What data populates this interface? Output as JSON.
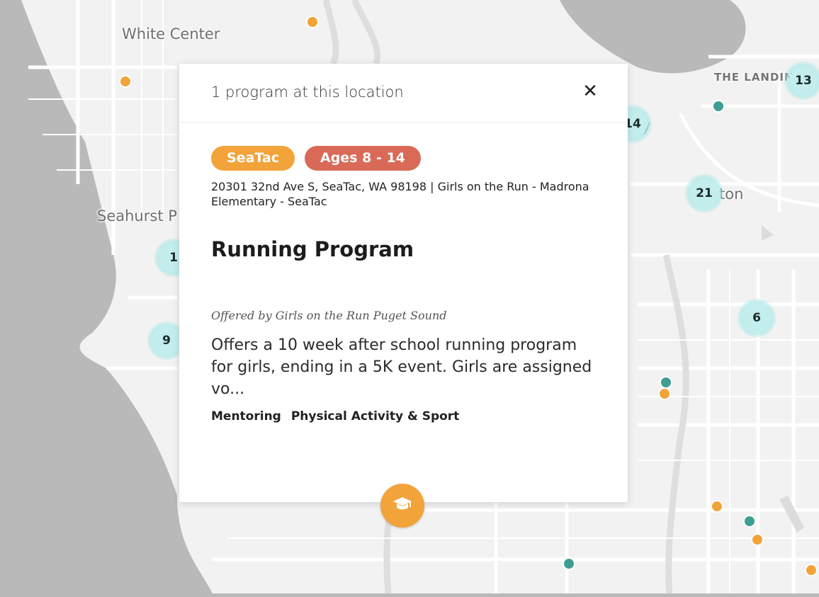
{
  "map": {
    "place_labels": [
      "White Center",
      "Seahurst P",
      "THE LANDIN",
      "ay",
      "ton"
    ],
    "clusters": [
      "13",
      "14",
      "21",
      "6",
      "1",
      "9"
    ],
    "colors": {
      "land": "#f2f2f2",
      "water": "#b9b9b9",
      "road": "#ffffff",
      "orange_dot": "#f2a33a",
      "teal_dot": "#3f9e93",
      "cluster": "#c4eeee"
    }
  },
  "modal": {
    "title": "1 program at this location",
    "close_icon": "close-icon",
    "badges": [
      {
        "label": "SeaTac",
        "color": "#f2a33a"
      },
      {
        "label": "Ages 8 - 14",
        "color": "#d96a57"
      }
    ],
    "address": "20301 32nd Ave S, SeaTac, WA 98198 | Girls on the Run - Madrona Elementary - SeaTac",
    "program_title": "Running Program",
    "offered_by": "Offered by Girls on the Run Puget Sound",
    "description": "Offers a 10 week after school running program for girls, ending in a 5K event. Girls are assigned vo...",
    "tags": [
      "Mentoring",
      "Physical Activity & Sport"
    ]
  },
  "marker": {
    "icon": "graduation-cap-icon",
    "color": "#f2a33a"
  }
}
